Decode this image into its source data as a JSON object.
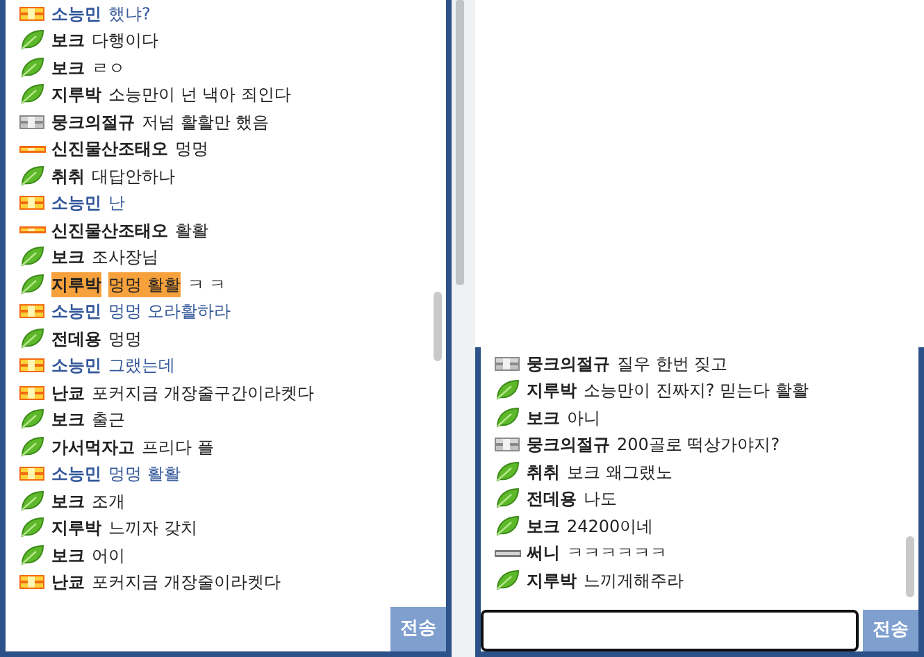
{
  "left_chat": {
    "messages": [
      {
        "kind": "gold",
        "name": "소능민",
        "message": "했냐?",
        "color": "#34589a",
        "highlighted": false
      },
      {
        "kind": "leaf",
        "name": "보크",
        "message": "다행이다",
        "color": "#222222",
        "highlighted": false
      },
      {
        "kind": "leaf",
        "name": "보크",
        "message": "ㄹㅇ",
        "color": "#222222",
        "highlighted": false
      },
      {
        "kind": "leaf",
        "name": "지루박",
        "message": "소능만이 넌 낵아 죄인다",
        "color": "#222222",
        "highlighted": false
      },
      {
        "kind": "silver",
        "name": "뭉크의절규",
        "message": "저넘 활활만 했음",
        "color": "#222222",
        "highlighted": false
      },
      {
        "kind": "thin",
        "name": "신진물산조태오",
        "message": "멍멍",
        "color": "#222222",
        "highlighted": false
      },
      {
        "kind": "leaf",
        "name": "취취",
        "message": "대답안하나",
        "color": "#222222",
        "highlighted": false
      },
      {
        "kind": "gold",
        "name": "소능민",
        "message": "난",
        "color": "#34589a",
        "highlighted": false
      },
      {
        "kind": "thin",
        "name": "신진물산조태오",
        "message": "활활",
        "color": "#222222",
        "highlighted": false
      },
      {
        "kind": "leaf",
        "name": "보크",
        "message": "조사장님",
        "color": "#222222",
        "highlighted": false
      },
      {
        "kind": "leaf",
        "name": "지루박",
        "message": "멍멍 활활",
        "tail": "ㅋ ㅋ",
        "color": "#222222",
        "highlighted": true
      },
      {
        "kind": "gold",
        "name": "소능민",
        "message": "멍멍 오라활하라",
        "color": "#34589a",
        "highlighted": false
      },
      {
        "kind": "leaf",
        "name": "전데용",
        "message": "멍멍",
        "color": "#222222",
        "highlighted": false
      },
      {
        "kind": "gold",
        "name": "소능민",
        "message": "그랬는데",
        "color": "#34589a",
        "highlighted": false
      },
      {
        "kind": "gold",
        "name": "난쿄",
        "message": "포커지금 개장줄구간이라켓다",
        "color": "#222222",
        "highlighted": false
      },
      {
        "kind": "leaf",
        "name": "보크",
        "message": "출근",
        "color": "#222222",
        "highlighted": false
      },
      {
        "kind": "leaf",
        "name": "가서먹자고",
        "message": "프리다 플",
        "color": "#222222",
        "highlighted": false
      },
      {
        "kind": "gold",
        "name": "소능민",
        "message": "멍멍 활활",
        "color": "#34589a",
        "highlighted": false
      },
      {
        "kind": "leaf",
        "name": "보크",
        "message": "조개",
        "color": "#222222",
        "highlighted": false
      },
      {
        "kind": "leaf",
        "name": "지루박",
        "message": "느끼자 갖치",
        "color": "#222222",
        "highlighted": false
      },
      {
        "kind": "leaf",
        "name": "보크",
        "message": "어이",
        "color": "#222222",
        "highlighted": false
      },
      {
        "kind": "gold",
        "name": "난쿄",
        "message": "포커지금 개장줄이라켓다",
        "color": "#222222",
        "highlighted": false
      }
    ],
    "send_button": "전송"
  },
  "right_chat": {
    "messages": [
      {
        "kind": "silver",
        "name": "뭉크의절규",
        "message": "질우 한번 짖고",
        "color": "#222222",
        "highlighted": false
      },
      {
        "kind": "leaf",
        "name": "지루박",
        "message": "소능만이 진짜지? 믿는다 활활",
        "color": "#222222",
        "highlighted": false
      },
      {
        "kind": "leaf",
        "name": "보크",
        "message": "아니",
        "color": "#222222",
        "highlighted": false
      },
      {
        "kind": "silver",
        "name": "뭉크의절규",
        "message": "200골로 떡상가야지?",
        "color": "#222222",
        "highlighted": false
      },
      {
        "kind": "leaf",
        "name": "취취",
        "message": "보크 왜그랬노",
        "color": "#222222",
        "highlighted": false
      },
      {
        "kind": "leaf",
        "name": "전데용",
        "message": "나도",
        "color": "#222222",
        "highlighted": false
      },
      {
        "kind": "leaf",
        "name": "보크",
        "message": "24200이네",
        "color": "#222222",
        "highlighted": false
      },
      {
        "kind": "silver-thin",
        "name": "써니",
        "message": "ㅋㅋㅋㅋㅋㅋ",
        "color": "#222222",
        "highlighted": false
      },
      {
        "kind": "leaf",
        "name": "지루박",
        "message": "느끼게해주라",
        "color": "#222222",
        "highlighted": false
      }
    ],
    "input_focused": true,
    "send_button": "전송"
  }
}
